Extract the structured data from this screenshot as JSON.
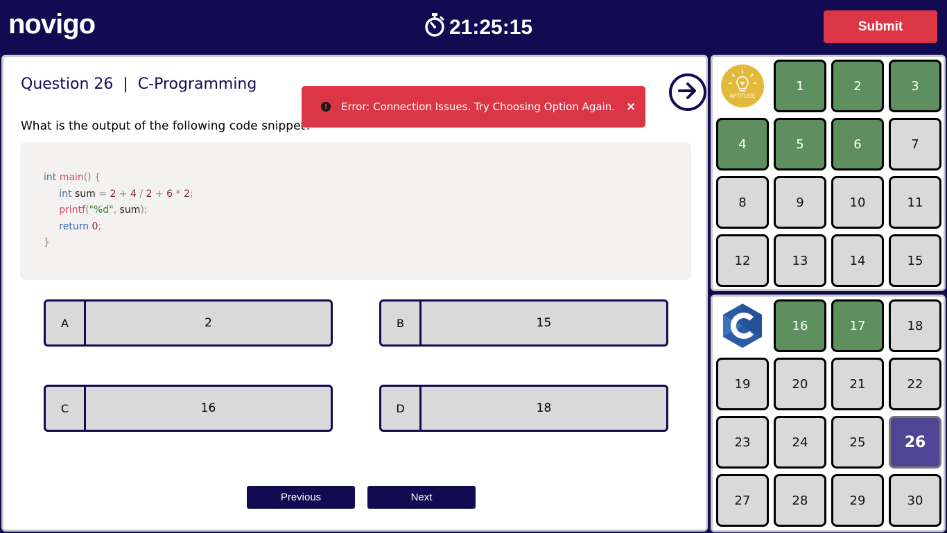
{
  "header": {
    "logo_text": "novigo",
    "timer": "21:25:15",
    "submit_label": "Submit"
  },
  "question": {
    "title": "Question 26  |  C-Programming",
    "text": "What is the output of the following code snippet?"
  },
  "code": {
    "l1_kw": "int",
    "l1_fn": "main",
    "l1_p": "() {",
    "l2_kw": "int",
    "l2_var": "sum",
    "l2_eq": "=",
    "l2_a": "2",
    "l2_op1": "+",
    "l2_b": "4",
    "l2_op2": "/",
    "l2_c": "2",
    "l2_op3": "+",
    "l2_d": "6",
    "l2_op4": "*",
    "l2_e": "2",
    "l2_end": ";",
    "l3_fn": "printf",
    "l3_p1": "(",
    "l3_str": "\"%d\"",
    "l3_p2": ", ",
    "l3_var": "sum",
    "l3_p3": ");",
    "l4_kw": "return",
    "l4_num": "0",
    "l4_end": ";",
    "l5": "}"
  },
  "options": [
    {
      "letter": "A",
      "value": "2"
    },
    {
      "letter": "B",
      "value": "15"
    },
    {
      "letter": "C",
      "value": "16"
    },
    {
      "letter": "D",
      "value": "18"
    }
  ],
  "nav": {
    "previous_label": "Previous",
    "next_label": "Next"
  },
  "toast": {
    "message": "Error: Connection Issues. Try Choosing Option Again.",
    "close": "×"
  },
  "sections": [
    {
      "logo": "aptitude-logo",
      "logo_text": "APTITUDE",
      "questions": [
        {
          "num": "1",
          "status": "answered"
        },
        {
          "num": "2",
          "status": "answered"
        },
        {
          "num": "3",
          "status": "answered"
        },
        {
          "num": "4",
          "status": "answered"
        },
        {
          "num": "5",
          "status": "answered"
        },
        {
          "num": "6",
          "status": "answered"
        },
        {
          "num": "7",
          "status": "unanswered"
        },
        {
          "num": "8",
          "status": "unanswered"
        },
        {
          "num": "9",
          "status": "unanswered"
        },
        {
          "num": "10",
          "status": "unanswered"
        },
        {
          "num": "11",
          "status": "unanswered"
        },
        {
          "num": "12",
          "status": "unanswered"
        },
        {
          "num": "13",
          "status": "unanswered"
        },
        {
          "num": "14",
          "status": "unanswered"
        },
        {
          "num": "15",
          "status": "unanswered"
        }
      ]
    },
    {
      "logo": "c-language-logo",
      "questions": [
        {
          "num": "16",
          "status": "answered"
        },
        {
          "num": "17",
          "status": "answered"
        },
        {
          "num": "18",
          "status": "unanswered"
        },
        {
          "num": "19",
          "status": "unanswered"
        },
        {
          "num": "20",
          "status": "unanswered"
        },
        {
          "num": "21",
          "status": "unanswered"
        },
        {
          "num": "22",
          "status": "unanswered"
        },
        {
          "num": "23",
          "status": "unanswered"
        },
        {
          "num": "24",
          "status": "unanswered"
        },
        {
          "num": "25",
          "status": "unanswered"
        },
        {
          "num": "26",
          "status": "current"
        },
        {
          "num": "27",
          "status": "unanswered"
        },
        {
          "num": "28",
          "status": "unanswered"
        },
        {
          "num": "29",
          "status": "unanswered"
        },
        {
          "num": "30",
          "status": "unanswered"
        }
      ]
    }
  ],
  "colors": {
    "brand": "#120b52",
    "answered": "#5e8f5e",
    "current": "#4f4594",
    "unanswered": "#d9d9d9",
    "error": "#dc3545",
    "aptitude_logo": "#e2b93b",
    "c_logo": "#2c5ba4"
  }
}
